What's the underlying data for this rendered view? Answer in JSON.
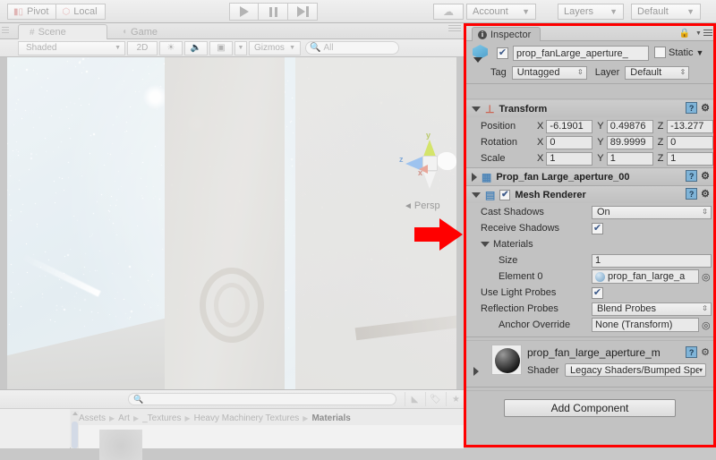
{
  "toolbar": {
    "pivot_label": "Pivot",
    "local_label": "Local",
    "play_icon": "play-icon",
    "pause_icon": "pause-icon",
    "step_icon": "step-icon",
    "cloud_icon": "cloud-icon",
    "account_label": "Account",
    "layers_label": "Layers",
    "layout_label": "Default"
  },
  "scene_panel": {
    "tabs": [
      {
        "label": "Scene",
        "icon": "grid-icon",
        "active": true
      },
      {
        "label": "Game",
        "icon": "gamepad-icon",
        "active": false
      }
    ],
    "tools": {
      "draw_mode": "Shaded",
      "view_2d": "2D",
      "light_icon": "sun-icon",
      "audio_icon": "speaker-icon",
      "fx_icon": "image-icon",
      "gizmos_label": "Gizmos",
      "search_placeholder": "All",
      "search_icon": "search-icon"
    },
    "gizmo": {
      "axis_x": "x",
      "axis_y": "y",
      "axis_z": "z",
      "projection_label": "Persp"
    },
    "annotation": {
      "arrow": "red-right-arrow"
    }
  },
  "project_panel": {
    "search_placeholder": "",
    "search_icon": "search-icon",
    "icons": [
      "filter-by-type-icon",
      "filter-by-label-icon",
      "favorites-star-icon"
    ],
    "breadcrumb": [
      "Assets",
      "Art",
      "_Textures",
      "Heavy Machinery Textures",
      "Materials"
    ]
  },
  "inspector": {
    "tab_label": "Inspector",
    "tab_icon": "info-icon",
    "lock_icon": "lock-icon",
    "menu_icon": "hamburger-menu-icon",
    "object": {
      "enabled": true,
      "name": "prop_fanLarge_aperture_",
      "static_label": "Static",
      "static_checked": false,
      "tag_label": "Tag",
      "tag_value": "Untagged",
      "layer_label": "Layer",
      "layer_value": "Default"
    },
    "transform": {
      "title": "Transform",
      "icon": "transform-axis-icon",
      "rows": [
        {
          "label": "Position",
          "x": "-6.1901",
          "y": "0.49876",
          "z": "-13.277"
        },
        {
          "label": "Rotation",
          "x": "0",
          "y": "89.9999",
          "z": "0"
        },
        {
          "label": "Scale",
          "x": "1",
          "y": "1",
          "z": "1"
        }
      ]
    },
    "mesh_filter": {
      "title": "Prop_fan Large_aperture_00",
      "icon": "mesh-filter-icon",
      "expanded": false
    },
    "mesh_renderer": {
      "title": "Mesh Renderer",
      "icon": "mesh-renderer-icon",
      "enabled": true,
      "cast_shadows_label": "Cast Shadows",
      "cast_shadows_value": "On",
      "receive_shadows_label": "Receive Shadows",
      "receive_shadows_checked": true,
      "materials_label": "Materials",
      "size_label": "Size",
      "size_value": "1",
      "element_label": "Element 0",
      "element_value": "prop_fan_large_a",
      "use_light_probes_label": "Use Light Probes",
      "use_light_probes_checked": true,
      "reflection_probes_label": "Reflection Probes",
      "reflection_probes_value": "Blend Probes",
      "anchor_override_label": "Anchor Override",
      "anchor_override_value": "None (Transform)"
    },
    "material": {
      "title": "prop_fan_large_aperture_m",
      "shader_label": "Shader",
      "shader_value": "Legacy Shaders/Bumped Spe"
    },
    "add_component_label": "Add Component"
  },
  "colors": {
    "annotation_red": "#ff0000",
    "inspector_bg": "#c2c2c2",
    "editor_chrome": "#eaeaea"
  }
}
